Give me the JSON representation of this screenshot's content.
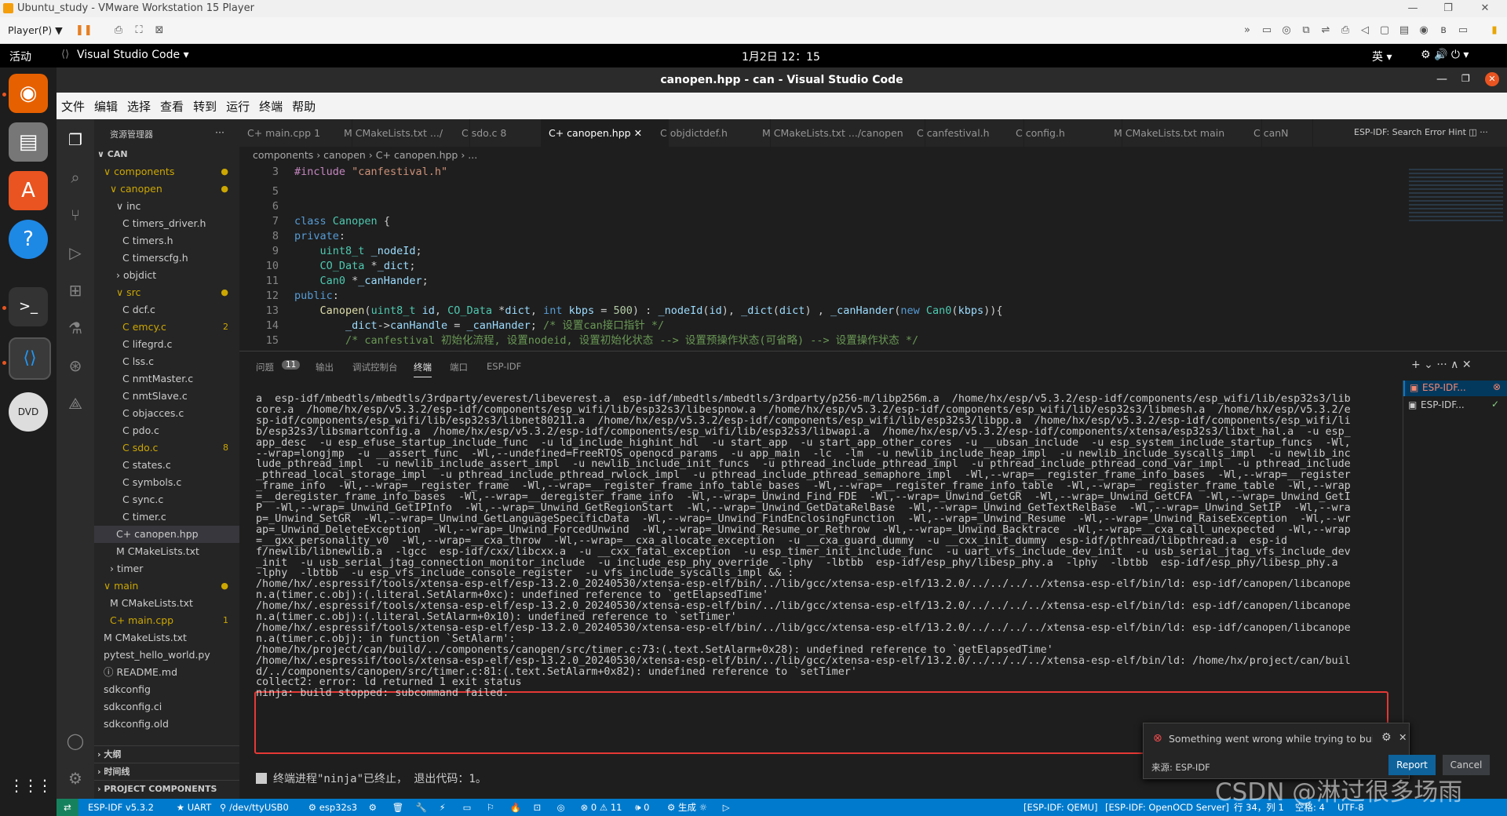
{
  "vmware": {
    "title": "Ubuntu_study - VMware Workstation 15 Player",
    "player_menu": "Player(P) ▼",
    "controls": [
      "—",
      "❐",
      "✕"
    ]
  },
  "ubuntu_topbar": {
    "activities": "活动",
    "app_menu": "Visual Studio Code ▾",
    "clock": "1月2日  12：15",
    "input_method": "英 ▾",
    "indicators": "⚙  🔊  ⏻ ▾"
  },
  "dock": {
    "apps": [
      {
        "name": "firefox",
        "glyph": "🦊",
        "color": "#e66000"
      },
      {
        "name": "files",
        "glyph": "🗀",
        "color": "#777"
      },
      {
        "name": "software",
        "glyph": "A",
        "color": "#e95420"
      },
      {
        "name": "help",
        "glyph": "?",
        "color": "#1e88e5"
      },
      {
        "name": "terminal",
        "glyph": ">_",
        "color": "#333"
      },
      {
        "name": "vscode",
        "glyph": "⟨⟩",
        "color": "#1565c0"
      },
      {
        "name": "dvd",
        "glyph": "DVD",
        "color": "#ccc"
      }
    ],
    "show_apps": "⋮⋮⋮"
  },
  "vscode": {
    "window_title": "canopen.hpp - can - Visual Studio Code",
    "menu": [
      "文件",
      "编辑",
      "选择",
      "查看",
      "转到",
      "运行",
      "终端",
      "帮助"
    ],
    "explorer_title": "资源管理器",
    "explorer_more": "···",
    "tree": [
      {
        "label": "∨ CAN",
        "indent": 0,
        "bold": true,
        "badge": ""
      },
      {
        "label": "∨ components",
        "indent": 1,
        "color": "#cca700",
        "badge": "●"
      },
      {
        "label": "∨ canopen",
        "indent": 2,
        "color": "#cca700",
        "badge": "●"
      },
      {
        "label": "∨ inc",
        "indent": 3,
        "badge": ""
      },
      {
        "label": "C timers_driver.h",
        "indent": 4,
        "badge": ""
      },
      {
        "label": "C timers.h",
        "indent": 4,
        "badge": ""
      },
      {
        "label": "C timerscfg.h",
        "indent": 4,
        "badge": ""
      },
      {
        "label": "› objdict",
        "indent": 3,
        "badge": ""
      },
      {
        "label": "∨ src",
        "indent": 3,
        "color": "#cca700",
        "badge": "●"
      },
      {
        "label": "C dcf.c",
        "indent": 4,
        "badge": ""
      },
      {
        "label": "C emcy.c",
        "indent": 4,
        "color": "#cca700",
        "badge": "2"
      },
      {
        "label": "C lifegrd.c",
        "indent": 4,
        "badge": ""
      },
      {
        "label": "C lss.c",
        "indent": 4,
        "badge": ""
      },
      {
        "label": "C nmtMaster.c",
        "indent": 4,
        "badge": ""
      },
      {
        "label": "C nmtSlave.c",
        "indent": 4,
        "badge": ""
      },
      {
        "label": "C objacces.c",
        "indent": 4,
        "badge": ""
      },
      {
        "label": "C pdo.c",
        "indent": 4,
        "badge": ""
      },
      {
        "label": "C sdo.c",
        "indent": 4,
        "color": "#cca700",
        "badge": "8"
      },
      {
        "label": "C states.c",
        "indent": 4,
        "badge": ""
      },
      {
        "label": "C symbols.c",
        "indent": 4,
        "badge": ""
      },
      {
        "label": "C sync.c",
        "indent": 4,
        "badge": ""
      },
      {
        "label": "C timer.c",
        "indent": 4,
        "badge": ""
      },
      {
        "label": "C+ canopen.hpp",
        "indent": 3,
        "badge": "",
        "selected": true
      },
      {
        "label": "M CMakeLists.txt",
        "indent": 3,
        "badge": ""
      },
      {
        "label": "› timer",
        "indent": 2,
        "badge": ""
      },
      {
        "label": "∨ main",
        "indent": 1,
        "color": "#cca700",
        "badge": "●"
      },
      {
        "label": "M CMakeLists.txt",
        "indent": 2,
        "badge": ""
      },
      {
        "label": "C+ main.cpp",
        "indent": 2,
        "color": "#cca700",
        "badge": "1"
      },
      {
        "label": "M CMakeLists.txt",
        "indent": 1,
        "badge": ""
      },
      {
        "label": "pytest_hello_world.py",
        "indent": 1,
        "badge": ""
      },
      {
        "label": "ⓘ README.md",
        "indent": 1,
        "badge": ""
      },
      {
        "label": "sdkconfig",
        "indent": 1,
        "badge": ""
      },
      {
        "label": "sdkconfig.ci",
        "indent": 1,
        "badge": ""
      },
      {
        "label": "sdkconfig.old",
        "indent": 1,
        "badge": ""
      }
    ],
    "sections": [
      "› 大纲",
      "› 时间线",
      "› PROJECT COMPONENTS"
    ],
    "tabs": [
      {
        "label": "C+ main.cpp  1",
        "active": false
      },
      {
        "label": "M CMakeLists.txt  .../",
        "active": false
      },
      {
        "label": "C sdo.c  8",
        "active": false
      },
      {
        "label": "C+ canopen.hpp  ✕",
        "active": true
      },
      {
        "label": "C objdictdef.h",
        "active": false
      },
      {
        "label": "M CMakeLists.txt  .../canopen",
        "active": false
      },
      {
        "label": "C canfestival.h",
        "active": false
      },
      {
        "label": "C config.h",
        "active": false
      },
      {
        "label": "M CMakeLists.txt  main",
        "active": false
      },
      {
        "label": "C canN",
        "active": false
      }
    ],
    "tab_actions": "ESP-IDF: Search Error Hint  ◫  ···",
    "breadcrumb": "components  ›  canopen  ›  C+ canopen.hpp  ›  ...",
    "code_lines": [
      {
        "n": "3",
        "html": "<span class='pp'>#include</span> <span class='str'>\"canfestival.h\"</span>"
      },
      {
        "n": "5",
        "html": ""
      },
      {
        "n": "6",
        "html": ""
      },
      {
        "n": "7",
        "html": "<span class='kw'>class</span> <span class='ty'>Canopen</span> {"
      },
      {
        "n": "8",
        "html": "<span class='kw'>private</span>:"
      },
      {
        "n": "9",
        "html": "    <span class='ty'>uint8_t</span> <span class='vr'>_nodeId</span>;"
      },
      {
        "n": "10",
        "html": "    <span class='ty'>CO_Data</span> *<span class='vr'>_dict</span>;"
      },
      {
        "n": "11",
        "html": "    <span class='ty'>Can0</span> *<span class='vr'>_canHander</span>;"
      },
      {
        "n": "12",
        "html": "<span class='kw'>public</span>:"
      },
      {
        "n": "13",
        "html": "    <span class='fn'>Canopen</span>(<span class='ty'>uint8_t</span> <span class='vr'>id</span>, <span class='ty'>CO_Data</span> *<span class='vr'>dict</span>, <span class='kw'>int</span> <span class='vr'>kbps</span> = <span class='num'>500</span>) : <span class='vr'>_nodeId</span>(<span class='vr'>id</span>), <span class='vr'>_dict</span>(<span class='vr'>dict</span>) , <span class='vr'>_canHander</span>(<span class='kw'>new</span> <span class='ty'>Can0</span>(<span class='vr'>kbps</span>)){"
      },
      {
        "n": "14",
        "html": "        <span class='vr'>_dict</span>-><span class='vr'>canHandle</span> = <span class='vr'>_canHander</span>; <span class='cm'>/* 设置can接口指针 */</span>"
      },
      {
        "n": "15",
        "html": "        <span class='cm'>/* canfestival 初始化流程, 设置nodeid, 设置初始化状态 --> 设置预操作状态(可省略) --> 设置操作状态 */</span>"
      }
    ],
    "panel_tabs": [
      "问题",
      "输出",
      "调试控制台",
      "终端",
      "端口",
      "ESP-IDF"
    ],
    "problems_count": "11",
    "panel_actions": "+ ⌄  ···  ∧  ✕",
    "terminal_lines": [
      "a  esp-idf/mbedtls/mbedtls/3rdparty/everest/libeverest.a  esp-idf/mbedtls/mbedtls/3rdparty/p256-m/libp256m.a  /home/hx/esp/v5.3.2/esp-idf/components/esp_wifi/lib/esp32s3/lib",
      "core.a  /home/hx/esp/v5.3.2/esp-idf/components/esp_wifi/lib/esp32s3/libespnow.a  /home/hx/esp/v5.3.2/esp-idf/components/esp_wifi/lib/esp32s3/libmesh.a  /home/hx/esp/v5.3.2/e",
      "sp-idf/components/esp_wifi/lib/esp32s3/libnet80211.a  /home/hx/esp/v5.3.2/esp-idf/components/esp_wifi/lib/esp32s3/libpp.a  /home/hx/esp/v5.3.2/esp-idf/components/esp_wifi/li",
      "b/esp32s3/libsmartconfig.a  /home/hx/esp/v5.3.2/esp-idf/components/esp_wifi/lib/esp32s3/libwapi.a  /home/hx/esp/v5.3.2/esp-idf/components/xtensa/esp32s3/libxt_hal.a  -u esp_",
      "app_desc  -u esp_efuse_startup_include_func  -u ld_include_highint_hdl  -u start_app  -u start_app_other_cores  -u __ubsan_include  -u esp_system_include_startup_funcs  -Wl,",
      "--wrap=longjmp  -u __assert_func  -Wl,--undefined=FreeRTOS_openocd_params  -u app_main  -lc  -lm  -u newlib_include_heap_impl  -u newlib_include_syscalls_impl  -u newlib_inc",
      "lude_pthread_impl  -u newlib_include_assert_impl  -u newlib_include_init_funcs  -u pthread_include_pthread_impl  -u pthread_include_pthread_cond_var_impl  -u pthread_include",
      "_pthread_local_storage_impl  -u pthread_include_pthread_rwlock_impl  -u pthread_include_pthread_semaphore_impl  -Wl,--wrap=__register_frame_info_bases  -Wl,--wrap=__register",
      "_frame_info  -Wl,--wrap=__register_frame  -Wl,--wrap=__register_frame_info_table_bases  -Wl,--wrap=__register_frame_info_table  -Wl,--wrap=__register_frame_table  -Wl,--wrap",
      "=__deregister_frame_info_bases  -Wl,--wrap=__deregister_frame_info  -Wl,--wrap=_Unwind_Find_FDE  -Wl,--wrap=_Unwind_GetGR  -Wl,--wrap=_Unwind_GetCFA  -Wl,--wrap=_Unwind_GetI",
      "P  -Wl,--wrap=_Unwind_GetIPInfo  -Wl,--wrap=_Unwind_GetRegionStart  -Wl,--wrap=_Unwind_GetDataRelBase  -Wl,--wrap=_Unwind_GetTextRelBase  -Wl,--wrap=_Unwind_SetIP  -Wl,--wra",
      "p=_Unwind_SetGR  -Wl,--wrap=_Unwind_GetLanguageSpecificData  -Wl,--wrap=_Unwind_FindEnclosingFunction  -Wl,--wrap=_Unwind_Resume  -Wl,--wrap=_Unwind_RaiseException  -Wl,--wr",
      "ap=_Unwind_DeleteException  -Wl,--wrap=_Unwind_ForcedUnwind  -Wl,--wrap=_Unwind_Resume_or_Rethrow  -Wl,--wrap=_Unwind_Backtrace  -Wl,--wrap=__cxa_call_unexpected  -Wl,--wrap",
      "=__gxx_personality_v0  -Wl,--wrap=__cxa_throw  -Wl,--wrap=__cxa_allocate_exception  -u __cxa_guard_dummy  -u __cxx_init_dummy  esp-idf/pthread/libpthread.a  esp-id",
      "f/newlib/libnewlib.a  -lgcc  esp-idf/cxx/libcxx.a  -u __cxx_fatal_exception  -u esp_timer_init_include_func  -u uart_vfs_include_dev_init  -u usb_serial_jtag_vfs_include_dev",
      "_init  -u usb_serial_jtag_connection_monitor_include  -u include_esp_phy_override  -lphy  -lbtbb  esp-idf/esp_phy/libesp_phy.a  -lphy  -lbtbb  esp-idf/esp_phy/libesp_phy.a  ",
      "-lphy  -lbtbb  -u esp_vfs_include_console_register  -u vfs_include_syscalls_impl && :",
      "/home/hx/.espressif/tools/xtensa-esp-elf/esp-13.2.0_20240530/xtensa-esp-elf/bin/../lib/gcc/xtensa-esp-elf/13.2.0/../../../../xtensa-esp-elf/bin/ld: esp-idf/canopen/libcanope",
      "n.a(timer.c.obj):(.literal.SetAlarm+0xc): undefined reference to `getElapsedTime'",
      "/home/hx/.espressif/tools/xtensa-esp-elf/esp-13.2.0_20240530/xtensa-esp-elf/bin/../lib/gcc/xtensa-esp-elf/13.2.0/../../../../xtensa-esp-elf/bin/ld: esp-idf/canopen/libcanope",
      "n.a(timer.c.obj):(.literal.SetAlarm+0x10): undefined reference to `setTimer'",
      "/home/hx/.espressif/tools/xtensa-esp-elf/esp-13.2.0_20240530/xtensa-esp-elf/bin/../lib/gcc/xtensa-esp-elf/13.2.0/../../../../xtensa-esp-elf/bin/ld: esp-idf/canopen/libcanope",
      "n.a(timer.c.obj): in function `SetAlarm':",
      "/home/hx/project/can/build/../components/canopen/src/timer.c:73:(.text.SetAlarm+0x28): undefined reference to `getElapsedTime'",
      "/home/hx/.espressif/tools/xtensa-esp-elf/esp-13.2.0_20240530/xtensa-esp-elf/bin/../lib/gcc/xtensa-esp-elf/13.2.0/../../../../xtensa-esp-elf/bin/ld: /home/hx/project/can/buil",
      "d/../components/canopen/src/timer.c:81:(.text.SetAlarm+0x82): undefined reference to `setTimer'",
      "collect2: error: ld returned 1 exit status",
      "ninja: build stopped: subcommand failed."
    ],
    "terminal_end": "终端进程\"ninja\"已终止， 退出代码：1。",
    "terminal_list": [
      "ESP-IDF...",
      "ESP-IDF..."
    ],
    "notification": {
      "message": "Something went wrong while trying to build the project",
      "source": "来源: ESP-IDF",
      "report": "Report",
      "cancel": "Cancel"
    },
    "status": {
      "remote": "⇄",
      "items_left": [
        "ESP-IDF v5.3.2",
        "★ UART",
        "⚲ /dev/ttyUSB0",
        "⚙ esp32s3",
        "⚙",
        "🗑",
        "🔧",
        "⚡",
        "▭",
        "⚐",
        "🔥",
        "⊡",
        "◎",
        "⊗ 0 ⚠ 11",
        "🕪 0",
        "⚙ 生成",
        "☼",
        "▷"
      ],
      "items_right": [
        "[ESP-IDF: QEMU]",
        "[ESP-IDF: OpenOCD Server]",
        "行 34，列 1",
        "空格: 4",
        "UTF-8"
      ]
    },
    "watermark": "CSDN @淋过很多场雨"
  },
  "colors": {
    "accent": "#007acc",
    "error_box": "#e53935",
    "ubuntu_orange": "#e95420",
    "report_button": "#0e639c"
  }
}
